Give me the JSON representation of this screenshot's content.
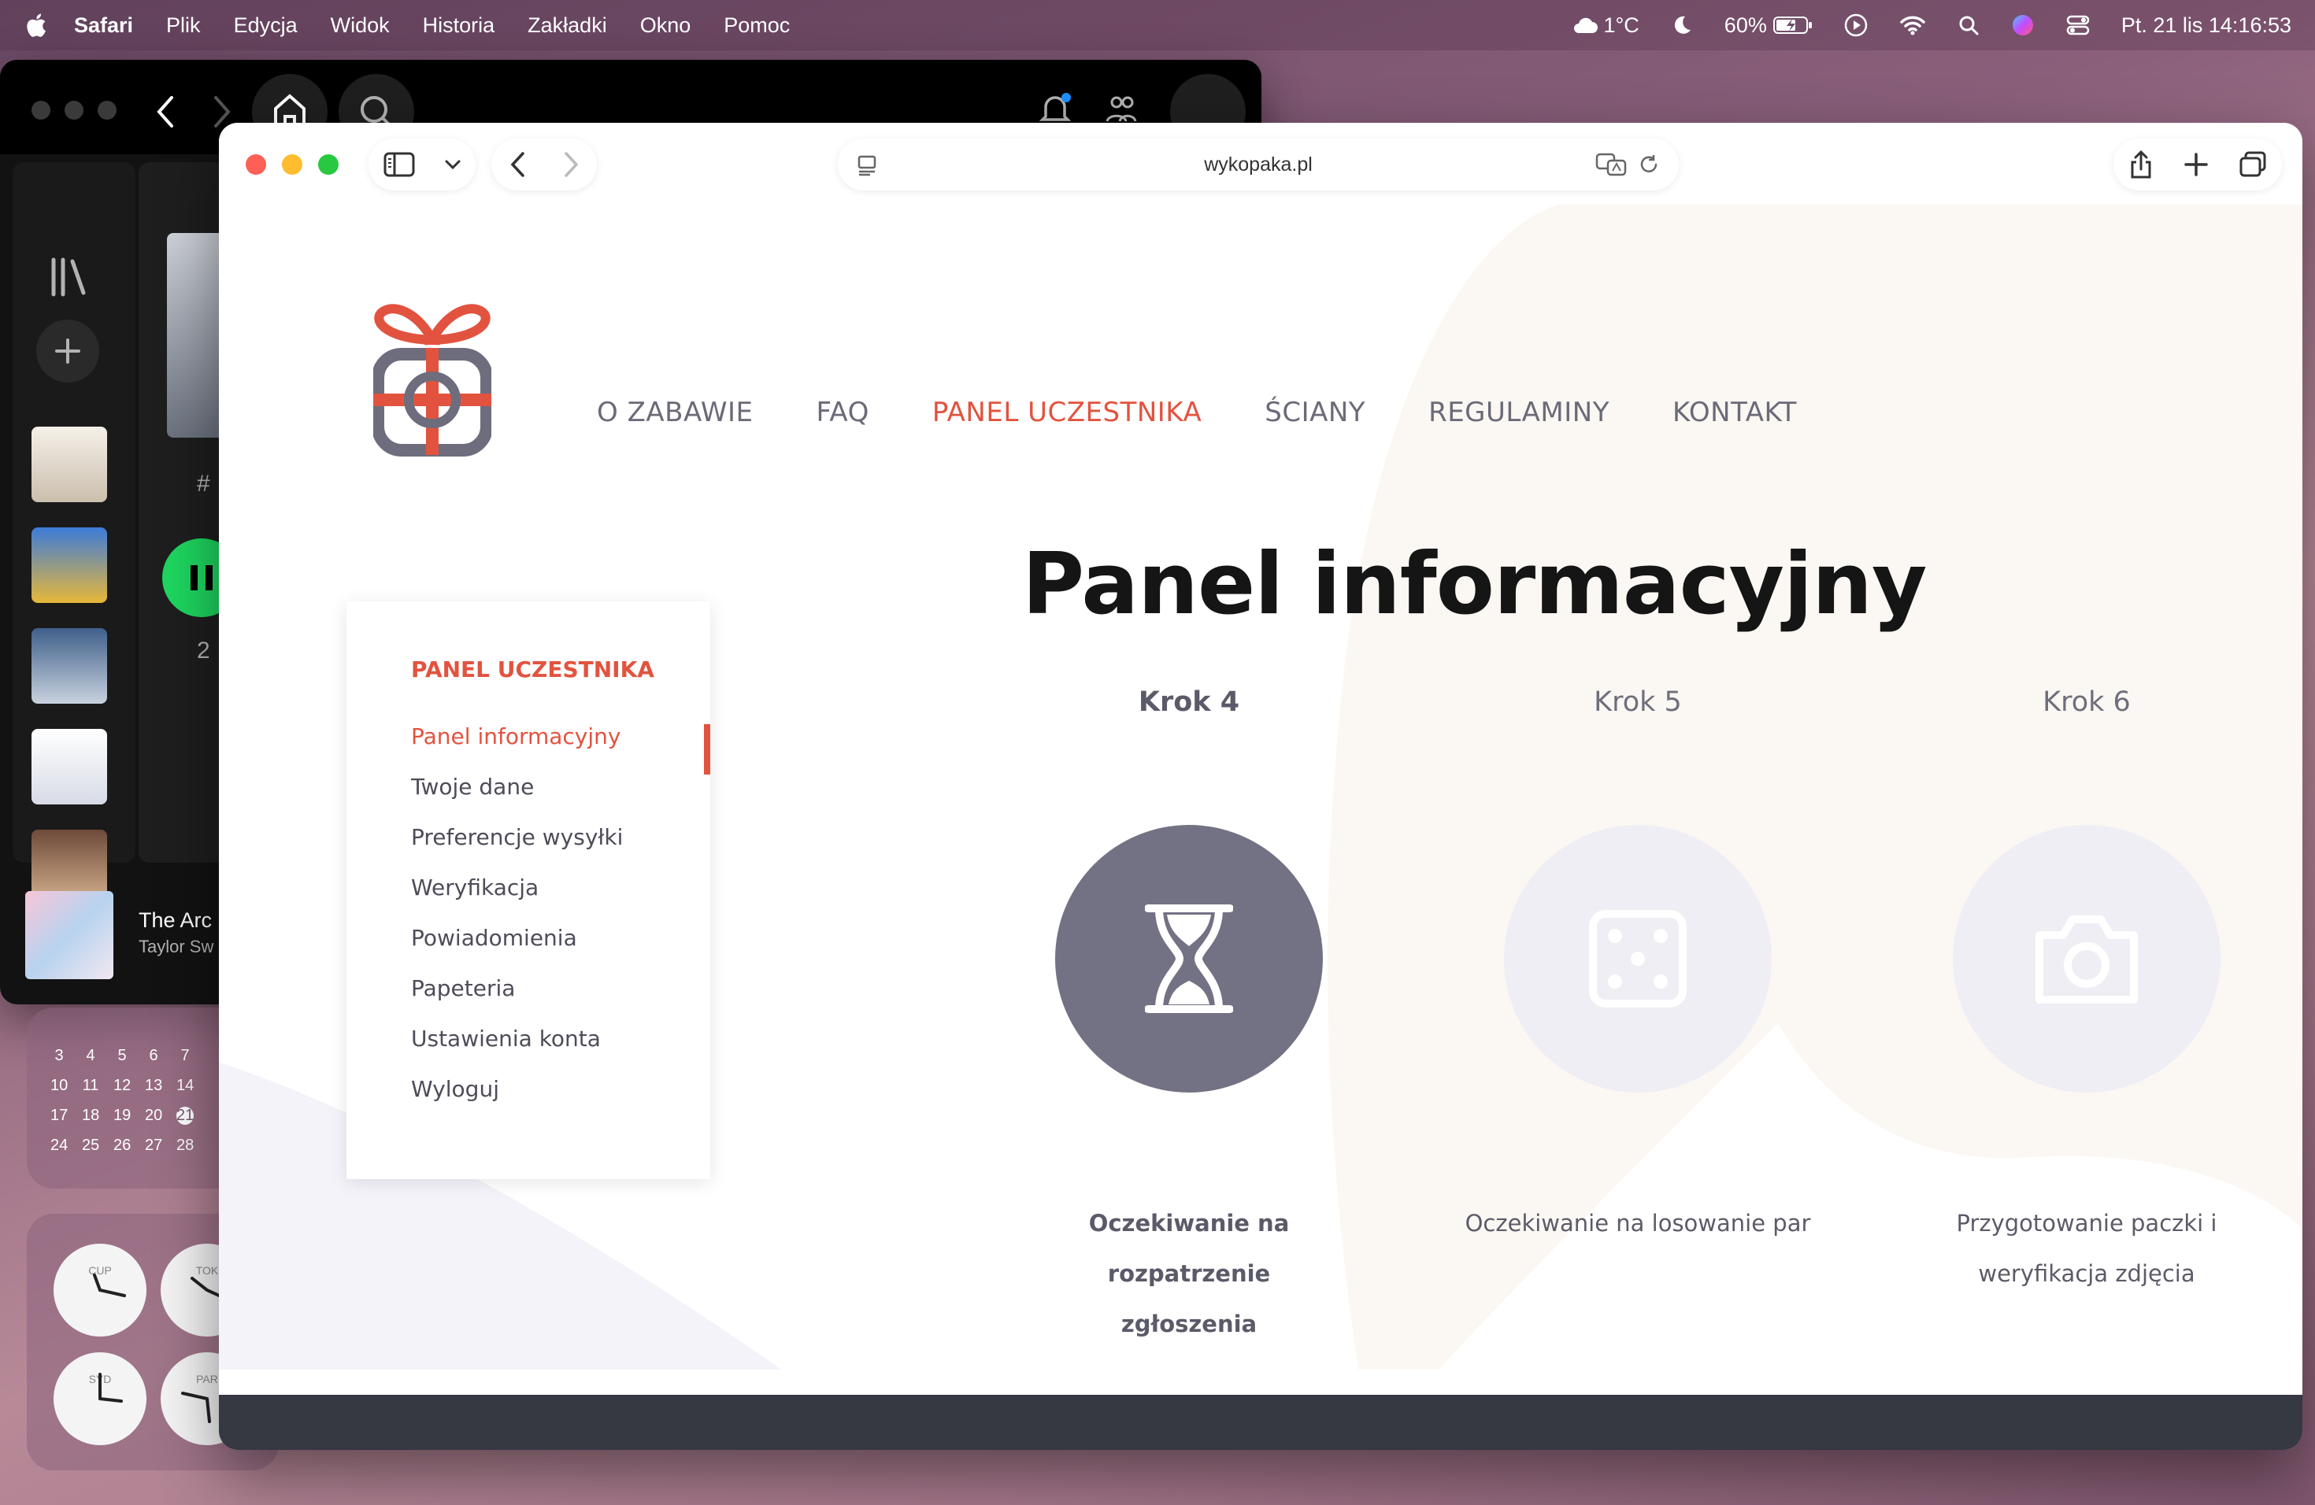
{
  "menubar": {
    "app": "Safari",
    "items": [
      "Plik",
      "Edycja",
      "Widok",
      "Historia",
      "Zakładki",
      "Okno",
      "Pomoc"
    ],
    "weather": "1°C",
    "battery": "60%",
    "datetime": "Pt. 21 lis  14:16:53"
  },
  "spotify": {
    "track": "The Arc",
    "artist": "Taylor Sw",
    "row_hash": "#",
    "row_number": "2"
  },
  "calendar": {
    "weeks": [
      [
        "3",
        "4",
        "5",
        "6",
        "7"
      ],
      [
        "10",
        "11",
        "12",
        "13",
        "14"
      ],
      [
        "17",
        "18",
        "19",
        "20",
        "21"
      ],
      [
        "24",
        "25",
        "26",
        "27",
        "28"
      ]
    ],
    "today": "21"
  },
  "clocks": [
    "CUP",
    "TOK",
    "SYD",
    "PAR"
  ],
  "browser": {
    "url": "wykopaka.pl"
  },
  "site": {
    "nav": [
      {
        "label": "O ZABAWIE",
        "active": false
      },
      {
        "label": "FAQ",
        "active": false
      },
      {
        "label": "PANEL UCZESTNIKA",
        "active": true
      },
      {
        "label": "ŚCIANY",
        "active": false
      },
      {
        "label": "REGULAMINY",
        "active": false
      },
      {
        "label": "KONTAKT",
        "active": false
      }
    ],
    "side_panel": {
      "heading": "PANEL UCZESTNIKA",
      "items": [
        {
          "label": "Panel informacyjny",
          "active": true
        },
        {
          "label": "Twoje dane",
          "active": false
        },
        {
          "label": "Preferencje wysyłki",
          "active": false
        },
        {
          "label": "Weryfikacja",
          "active": false
        },
        {
          "label": "Powiadomienia",
          "active": false
        },
        {
          "label": "Papeteria",
          "active": false
        },
        {
          "label": "Ustawienia konta",
          "active": false
        },
        {
          "label": "Wyloguj",
          "active": false
        }
      ]
    },
    "title": "Panel informacyjny",
    "steps": [
      {
        "label": "Krok 4",
        "text_line1": "Oczekiwanie na rozpatrzenie",
        "text_line2": "zgłoszenia",
        "status": "current",
        "icon": "hourglass-icon"
      },
      {
        "label": "Krok 5",
        "text_line1": "Oczekiwanie na losowanie par",
        "text_line2": "",
        "status": "pending",
        "icon": "dice-icon"
      },
      {
        "label": "Krok 6",
        "text_line1": "Przygotowanie paczki i",
        "text_line2": "weryfikacja zdjęcia",
        "status": "pending",
        "icon": "camera-icon"
      }
    ],
    "colors": {
      "accent": "#e2533f",
      "current_step": "#737284",
      "pending_step": "#eeeef4",
      "footer": "#363842"
    }
  }
}
